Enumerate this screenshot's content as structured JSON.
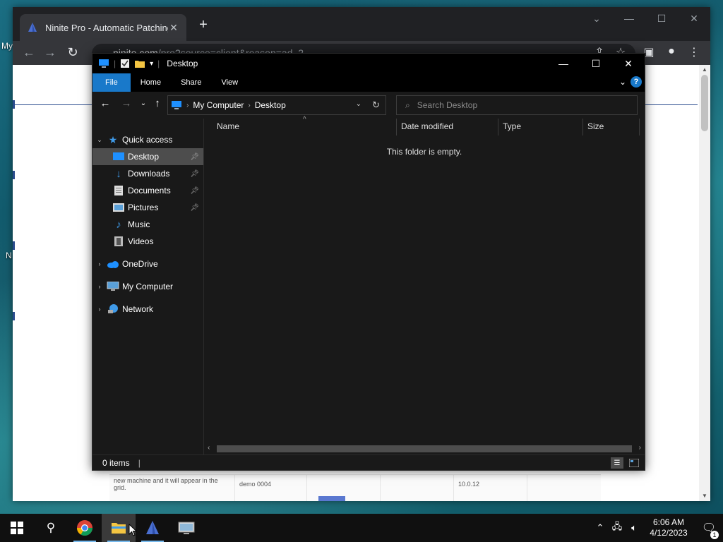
{
  "desktop": {
    "labels": [
      "My",
      "N"
    ]
  },
  "browser": {
    "tab_title": "Ninite Pro - Automatic Patching",
    "tab_close": "✕",
    "new_tab": "+",
    "url_host": "ninite.com",
    "url_path": "/pro?source=client&reason=ad_2",
    "page_grid": {
      "note_lines": "new machine and it will appear in the grid.",
      "machine": "demo 0004",
      "version": "10.0.12"
    }
  },
  "explorer": {
    "title": "Desktop",
    "ribbon_tabs": [
      "File",
      "Home",
      "Share",
      "View"
    ],
    "breadcrumb": [
      "My Computer",
      "Desktop"
    ],
    "search_placeholder": "Search Desktop",
    "nav": {
      "quick_access": "Quick access",
      "items": [
        {
          "label": "Desktop",
          "pinned": true,
          "selected": true
        },
        {
          "label": "Downloads",
          "pinned": true
        },
        {
          "label": "Documents",
          "pinned": true
        },
        {
          "label": "Pictures",
          "pinned": true
        },
        {
          "label": "Music",
          "pinned": false
        },
        {
          "label": "Videos",
          "pinned": false
        }
      ],
      "onedrive": "OneDrive",
      "my_computer": "My Computer",
      "network": "Network"
    },
    "columns": [
      "Name",
      "Date modified",
      "Type",
      "Size"
    ],
    "empty_message": "This folder is empty.",
    "status_items": "0 items"
  },
  "taskbar": {
    "time": "6:06 AM",
    "date": "4/12/2023",
    "notification_count": "1"
  },
  "colors": {
    "accent": "#1979ca",
    "explorer_bg": "#191919",
    "selected_bg": "#4d4d4d"
  }
}
